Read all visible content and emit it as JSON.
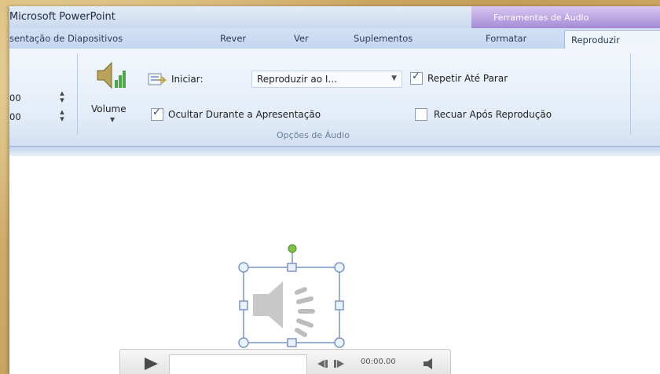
{
  "app": {
    "title": "Microsoft PowerPoint",
    "contextual_group": "Ferramentas de Áudio"
  },
  "tabs": [
    {
      "label": "sentação de Diapositivos"
    },
    {
      "label": "Rever"
    },
    {
      "label": "Ver"
    },
    {
      "label": "Suplementos"
    },
    {
      "label": "Formatar"
    },
    {
      "label": "Reproduzir"
    }
  ],
  "ribbon": {
    "spinner_top": "00",
    "spinner_bottom": "00",
    "volume_label": "Volume",
    "iniciar_label": "Iniciar:",
    "start_value": "Reproduzir ao I...",
    "repeat_label": "Repetir Até Parar",
    "repeat_checked": true,
    "hide_label": "Ocultar Durante a Apresentação",
    "hide_checked": true,
    "rewind_label": "Recuar Após Reprodução",
    "rewind_checked": false,
    "group_label": "Opções de Áudio"
  },
  "player": {
    "time": "00:00.00"
  },
  "icons": {
    "play": "play-icon",
    "speaker": "speaker-icon",
    "volume": "volume-icon"
  },
  "colors": {
    "contextual_tab": "#a58bd6",
    "rotate_handle": "#7ec04a",
    "selection_handle": "#9fbde2"
  }
}
